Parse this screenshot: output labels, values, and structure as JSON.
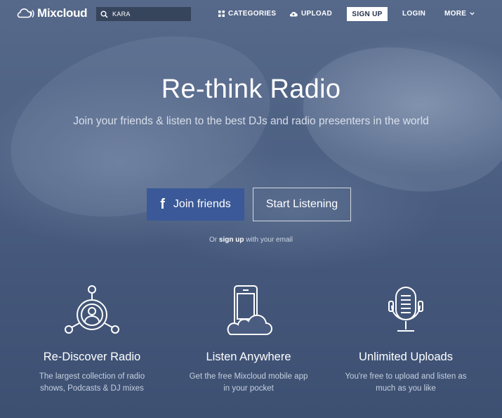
{
  "nav": {
    "logo_text": "Mixcloud",
    "search_value": "KARA",
    "categories_label": "CATEGORIES",
    "upload_label": "UPLOAD",
    "signup_label": "SIGN UP",
    "login_label": "LOGIN",
    "more_label": "MORE"
  },
  "hero": {
    "title": "Re-think Radio",
    "subtitle": "Join your friends & listen to the best DJs and radio presenters in the world",
    "join_friends_label": "Join friends",
    "start_listening_label": "Start Listening",
    "or_prefix": "Or",
    "or_link": "sign up",
    "or_suffix": "with your email"
  },
  "features": [
    {
      "icon": "radio-network-icon",
      "title": "Re-Discover Radio",
      "text": "The largest collection of radio shows, Podcasts & DJ mixes"
    },
    {
      "icon": "phone-cloud-icon",
      "title": "Listen Anywhere",
      "text": "Get the free Mixcloud mobile app in your pocket"
    },
    {
      "icon": "microphone-icon",
      "title": "Unlimited Uploads",
      "text": "You're free to upload and listen as much as you like"
    }
  ],
  "colors": {
    "facebook": "#3b5998",
    "hero_base": "#4c6083",
    "signup_text": "#23304a"
  }
}
